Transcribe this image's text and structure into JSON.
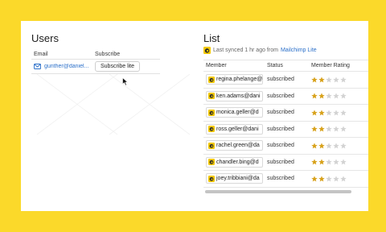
{
  "users": {
    "title": "Users",
    "columns": {
      "email": "Email",
      "subscribe": "Subscribe"
    },
    "rows": [
      {
        "email": "gunther@daniel...",
        "action": "Subscribe lite"
      }
    ]
  },
  "list": {
    "title": "List",
    "sync_text": "Last synced 1 hr ago from",
    "sync_link": "Mailchimp Lite",
    "columns": {
      "member": "Member",
      "status": "Status",
      "rating": "Member Rating"
    },
    "rows": [
      {
        "member": "regina.phelange@",
        "status": "subscribed",
        "rating": 2
      },
      {
        "member": "ken.adams@dani",
        "status": "subscribed",
        "rating": 2
      },
      {
        "member": "monica.geller@d",
        "status": "subscribed",
        "rating": 2
      },
      {
        "member": "ross.geller@dani",
        "status": "subscribed",
        "rating": 2
      },
      {
        "member": "rachel.green@da",
        "status": "subscribed",
        "rating": 2
      },
      {
        "member": "chandler.bing@d",
        "status": "subscribed",
        "rating": 2
      },
      {
        "member": "joey.tribbiani@da",
        "status": "subscribed",
        "rating": 2
      }
    ],
    "max_rating": 5
  },
  "colors": {
    "background": "#fbd92a",
    "link": "#2a6fc9",
    "star_filled": "#d8a21c",
    "star_empty": "#d3d3d3"
  },
  "icons": {
    "mail": "envelope-icon",
    "mailchimp": "mailchimp-logo-icon",
    "cursor": "mouse-pointer-icon",
    "star": "star-icon"
  }
}
